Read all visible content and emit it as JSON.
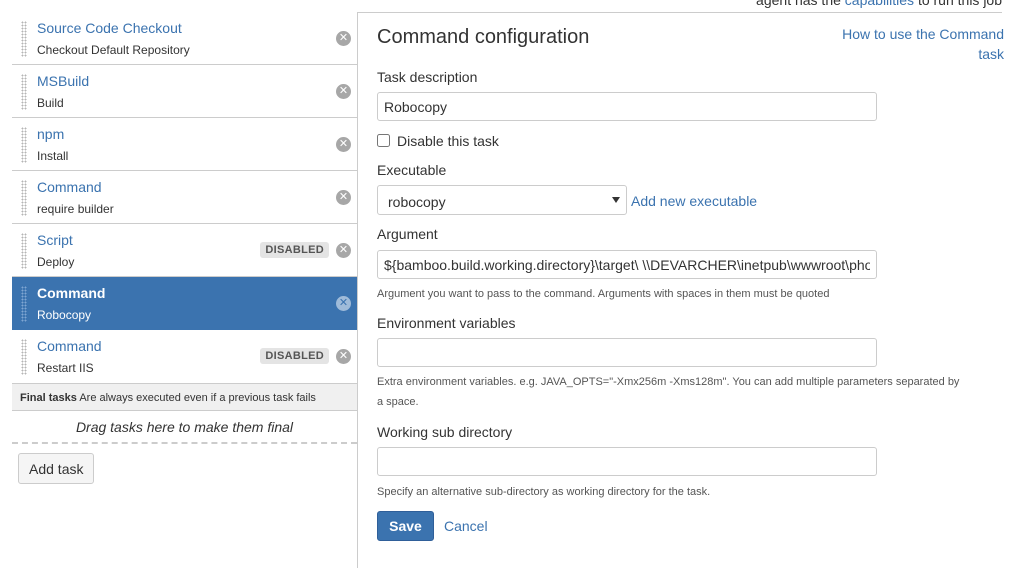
{
  "top_note": {
    "text_before": "agent has the ",
    "link": "capabilities",
    "text_after": " to run this job"
  },
  "tasks": [
    {
      "name": "Source Code Checkout",
      "description": "Checkout Default Repository",
      "badge": ""
    },
    {
      "name": "MSBuild",
      "description": "Build",
      "badge": ""
    },
    {
      "name": "npm",
      "description": "Install",
      "badge": ""
    },
    {
      "name": "Command",
      "description": "require builder",
      "badge": ""
    },
    {
      "name": "Script",
      "description": "Deploy",
      "badge": "DISABLED"
    },
    {
      "name": "Command",
      "description": "Robocopy",
      "badge": "",
      "active": true
    },
    {
      "name": "Command",
      "description": "Restart IIS",
      "badge": "DISABLED"
    }
  ],
  "final_tasks": {
    "title": "Final tasks",
    "subtitle": "Are always executed even if a previous task fails",
    "drop_text": "Drag tasks here to make them final"
  },
  "add_task_label": "Add task",
  "form": {
    "title": "Command configuration",
    "help_link": "How to use the Command task",
    "task_description_label": "Task description",
    "task_description_value": "Robocopy",
    "disable_label": "Disable this task",
    "disable_checked": false,
    "executable_label": "Executable",
    "executable_value": "robocopy",
    "add_executable_link": "Add new executable",
    "argument_label": "Argument",
    "argument_value": "${bamboo.build.working.directory}\\target\\ \\\\DEVARCHER\\inetpub\\wwwroot\\phoenix-config /MIR",
    "argument_hint": "Argument you want to pass to the command. Arguments with spaces in them must be quoted",
    "env_label": "Environment variables",
    "env_value": "",
    "env_hint": "Extra environment variables. e.g. JAVA_OPTS=\"-Xmx256m -Xms128m\". You can add multiple parameters separated by a space.",
    "workdir_label": "Working sub directory",
    "workdir_value": "",
    "workdir_hint": "Specify an alternative sub-directory as working directory for the task.",
    "save_label": "Save",
    "cancel_label": "Cancel"
  }
}
